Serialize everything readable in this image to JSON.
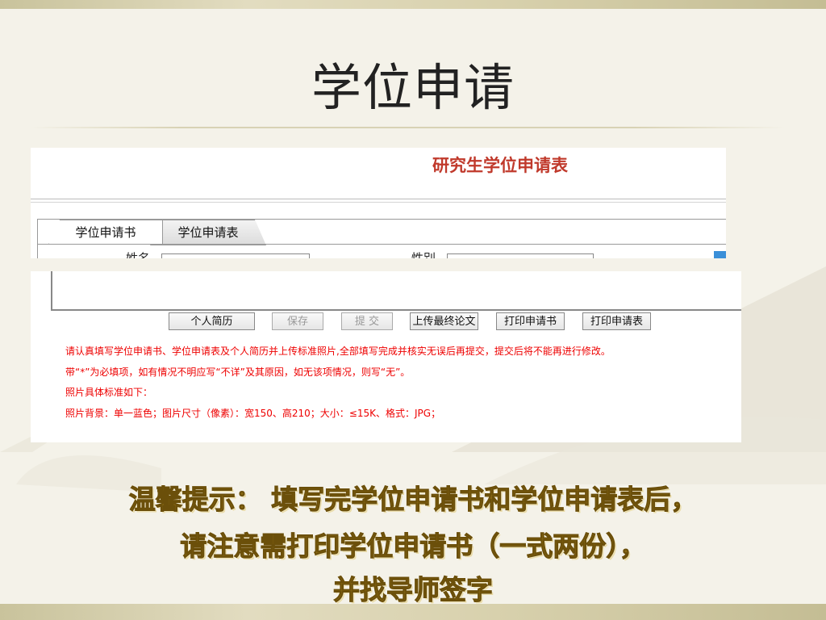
{
  "slide": {
    "title": "学位申请"
  },
  "form": {
    "title": "研究生学位申请表",
    "tabs": [
      {
        "label": "学位申请书",
        "active": true
      },
      {
        "label": "学位申请表",
        "active": false
      }
    ],
    "partial_labels": [
      "姓名",
      "性别"
    ],
    "buttons": [
      {
        "label": "个人简历",
        "enabled": true
      },
      {
        "label": "保存",
        "enabled": false
      },
      {
        "label": "提 交",
        "enabled": false
      },
      {
        "label": "上传最终论文",
        "enabled": true
      },
      {
        "label": "打印申请书",
        "enabled": true
      },
      {
        "label": "打印申请表",
        "enabled": true
      }
    ],
    "notes": [
      "请认真填写学位申请书、学位申请表及个人简历并上传标准照片,全部填写完成并核实无误后再提交，提交后将不能再进行修改。",
      "带“*”为必填项，如有情况不明应写“不详”及其原因，如无该项情况，则写“无”。",
      "照片具体标准如下：",
      "照片背景：单一蓝色；图片尺寸（像素）：宽150、高210；大小：≤15K、格式：JPG；"
    ]
  },
  "tip": {
    "line1": "温馨提示：  填写完学位申请书和学位申请表后，",
    "line2": "请注意需打印学位申请书（一式两份），",
    "line3": "并找导师签字"
  },
  "colors": {
    "form_title": "#c0392b",
    "notes": "#ee0000",
    "tip": "#8a6a14"
  }
}
